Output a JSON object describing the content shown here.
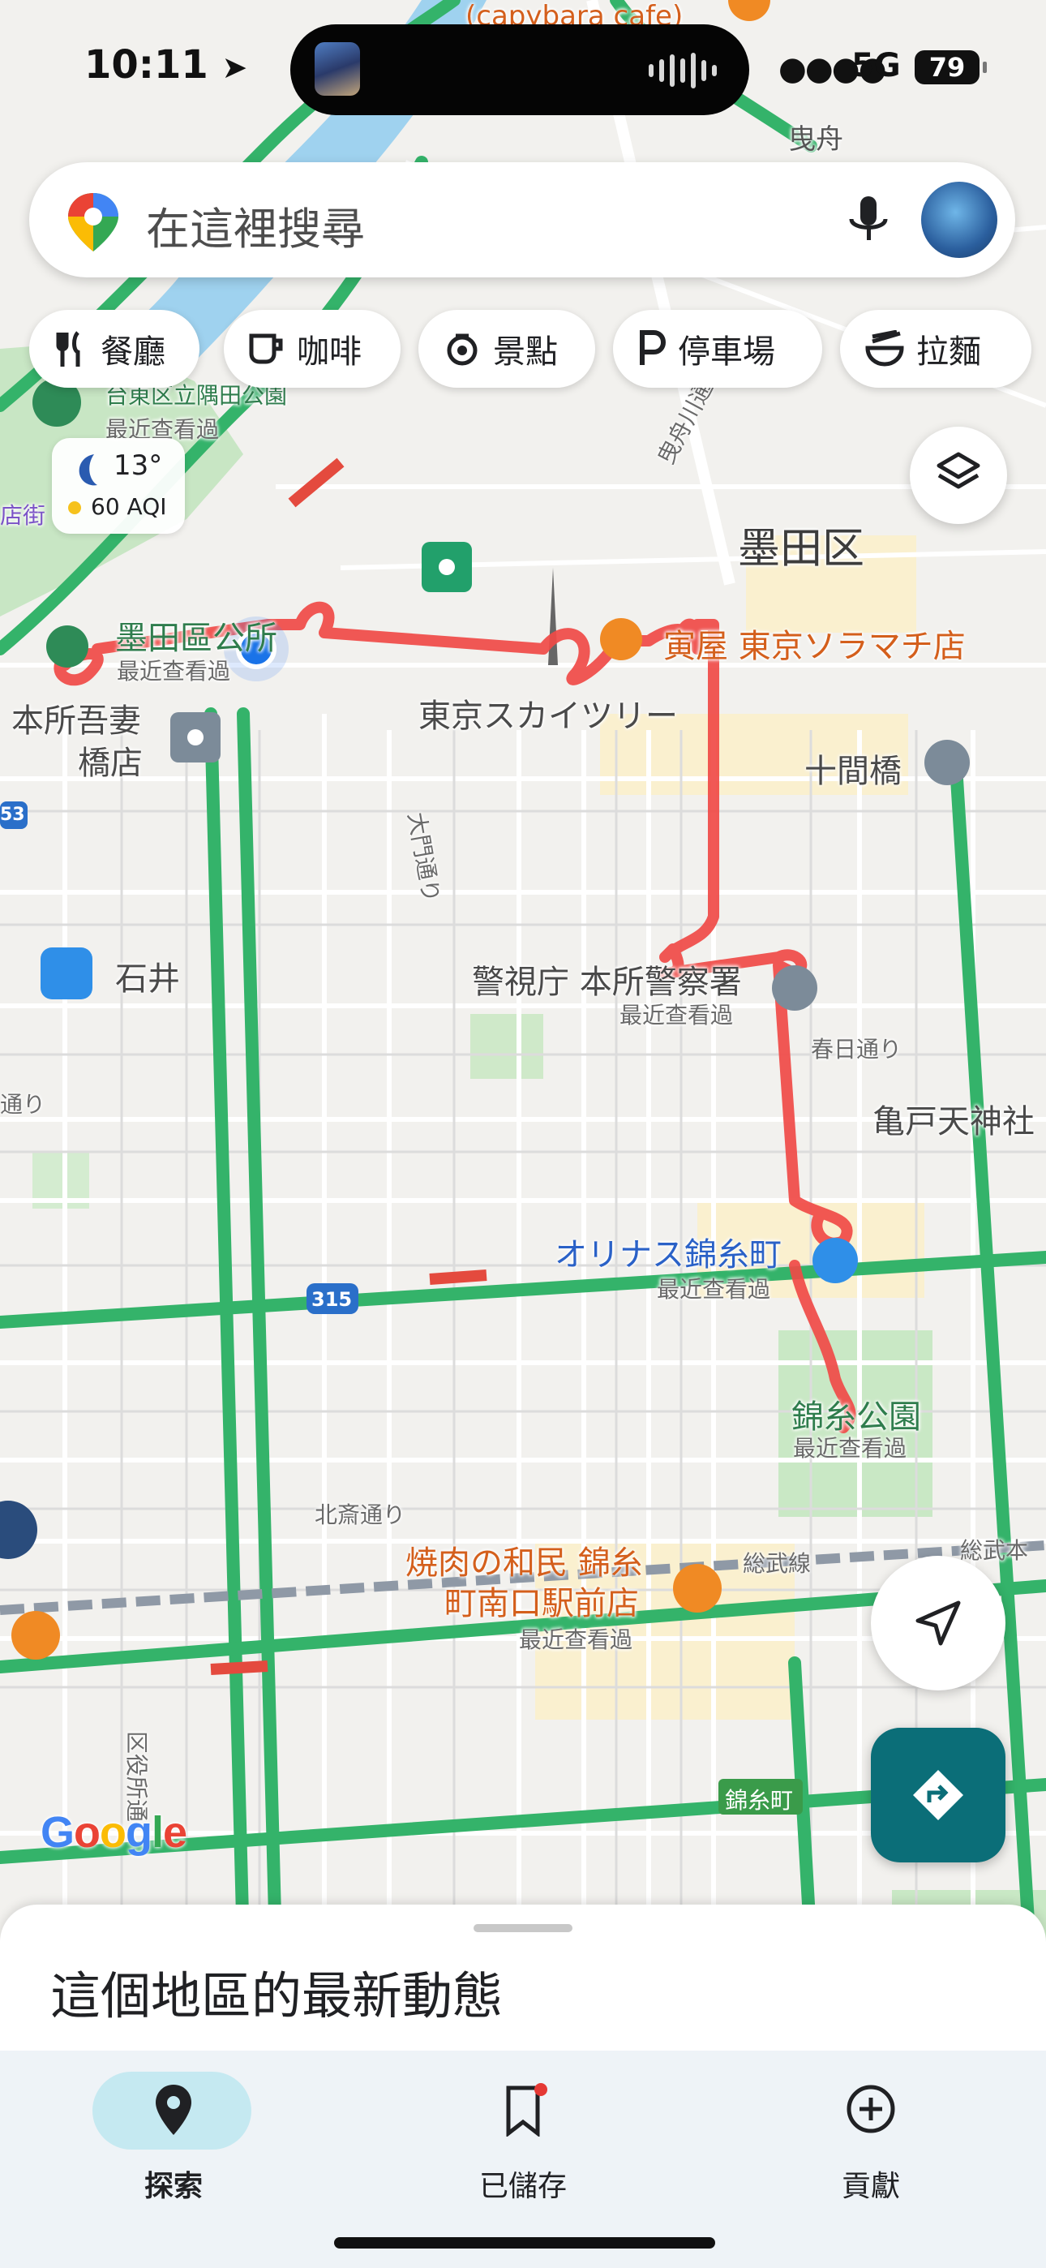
{
  "status_bar": {
    "time": "10:11",
    "network": "5G",
    "battery": "79"
  },
  "search": {
    "placeholder": "在這裡搜尋"
  },
  "chips": [
    {
      "label": "餐廳",
      "icon": "fork-knife-icon"
    },
    {
      "label": "咖啡",
      "icon": "coffee-cup-icon"
    },
    {
      "label": "景點",
      "icon": "camera-landmark-icon"
    },
    {
      "label": "停車場",
      "icon": "parking-icon"
    },
    {
      "label": "拉麵",
      "icon": "ramen-bowl-icon"
    }
  ],
  "weather": {
    "temp": "13°",
    "aqi": "60 AQI"
  },
  "map": {
    "labels": {
      "capybara": "(capybara cafe)",
      "hikifune": "曳舟",
      "sumida_ku": "墨田区",
      "park_tobu": "台東区立隅田公園",
      "recent1": "最近查看過",
      "sumida_office": "墨田區公所",
      "recent2": "最近查看過",
      "honjo_azuma1": "本所吾妻",
      "honjo_azuma2": "橋店",
      "skytree": "東京スカイツリー",
      "torakichi": "寅屋 東京ソラマチ店",
      "jukkenbashi": "十間橋",
      "daimon": "大門通り",
      "ishii": "石井",
      "police": "警視庁 本所警察署",
      "recent3": "最近查看過",
      "kasuga": "春日通り",
      "kameido": "亀戸天神社",
      "dori_left": "通り",
      "olinas": "オリナス錦糸町",
      "recent4": "最近查看過",
      "route315": "315",
      "kinshi_park": "錦糸公園",
      "recent5": "最近查看過",
      "hokusai": "北斎通り",
      "watami1": "焼肉の和民 錦糸",
      "watami2": "町南口駅前店",
      "recent6": "最近查看過",
      "sobu": "総武線",
      "sobu_right": "総武本",
      "kuyakusho": "区役所通",
      "kinshicho": "錦糸町",
      "hikifune_river": "曳舟川通",
      "edge_left": "店街",
      "route53": "53"
    }
  },
  "google_logo": "Google",
  "sheet": {
    "title": "這個地區的最新動態"
  },
  "nav": [
    {
      "label": "探索",
      "icon": "location-pin-icon",
      "active": true
    },
    {
      "label": "已儲存",
      "icon": "bookmark-icon",
      "active": false
    },
    {
      "label": "貢獻",
      "icon": "add-circle-icon",
      "active": false
    }
  ]
}
